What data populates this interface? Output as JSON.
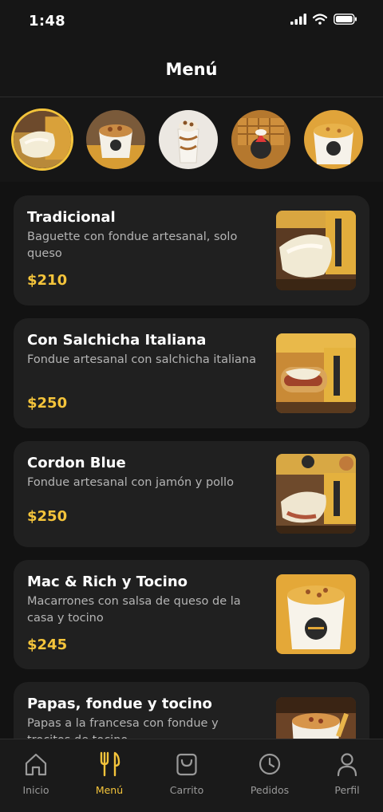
{
  "status_bar": {
    "time": "1:48"
  },
  "header": {
    "title": "Menú"
  },
  "categories": [
    {
      "icon": "cheese-baguette-photo"
    },
    {
      "icon": "loaded-bowl-photo"
    },
    {
      "icon": "dessert-shake-photo"
    },
    {
      "icon": "waffle-dessert-photo"
    },
    {
      "icon": "mac-and-cheese-cup-photo"
    }
  ],
  "menu": {
    "items": [
      {
        "name": "Tradicional",
        "description": "Baguette con fondue artesanal, solo queso",
        "price": "$210"
      },
      {
        "name": "Con Salchicha Italiana",
        "description": "Fondue artesanal con salchicha italiana",
        "price": "$250"
      },
      {
        "name": "Cordon Blue",
        "description": "Fondue artesanal con jamón y pollo",
        "price": "$250"
      },
      {
        "name": "Mac & Rich y Tocino",
        "description": "Macarrones con salsa de queso de la casa y tocino",
        "price": "$245"
      },
      {
        "name": "Papas, fondue y tocino",
        "description": "Papas a la francesa con fondue y trocitos de tocino",
        "price": ""
      }
    ]
  },
  "nav": {
    "inicio": "Inicio",
    "menu": "Menú",
    "carrito": "Carrito",
    "pedidos": "Pedidos",
    "perfil": "Perfil"
  },
  "colors": {
    "accent": "#f4c43b",
    "background": "#121212",
    "card": "#202020"
  }
}
